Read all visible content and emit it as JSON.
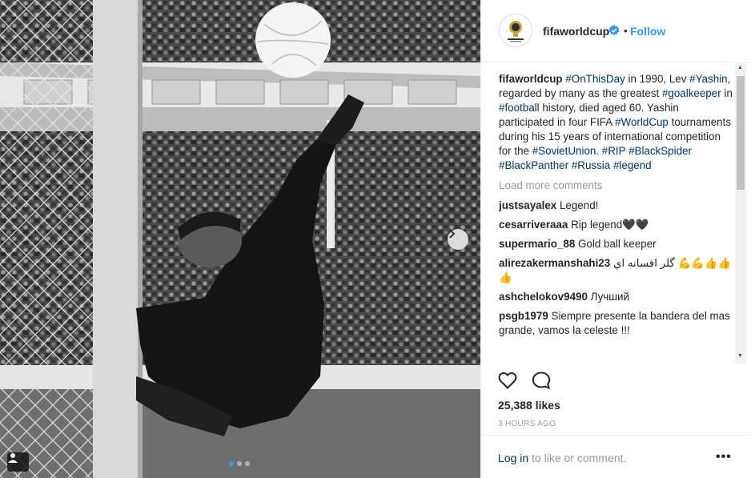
{
  "post": {
    "username": "fifaworldcup",
    "follow_label": "Follow",
    "separator": "•",
    "caption": {
      "p1": " ",
      "h1": "#OnThisDay",
      "p2": " in 1990, Lev ",
      "h2": "#Yashin",
      "p3": ", regarded by many as the greatest ",
      "h3": "#goalkeeper",
      "p4": " in ",
      "h4": "#football",
      "p5": " history, died aged 60. Yashin participated in four FIFA ",
      "h5": "#WorldCup",
      "p6": " tournaments during his 15 years of international competition for the ",
      "h6": "#SovietUnion",
      "p7": ". ",
      "h7": "#RIP",
      "h8": "#BlackSpider",
      "h9": "#BlackPanther",
      "h10": "#Russia",
      "h11": "#legend"
    },
    "load_more": "Load more comments",
    "comments": [
      {
        "user": "justsayalex",
        "text": "Legend!"
      },
      {
        "user": "cesarriveraaa",
        "text": "Rip legend🖤🖤"
      },
      {
        "user": "supermario_88",
        "text": "Gold ball keeper"
      },
      {
        "user": "alirezakermanshahi23",
        "text": "گلر افسانه اي 💪💪👍👍👍"
      },
      {
        "user": "ashchelokov9490",
        "text": "Лучший"
      },
      {
        "user": "psgb1979",
        "text": "Siempre presente la bandera del mas grande, vamos la celeste !!!"
      }
    ],
    "likes": "25,388 likes",
    "time": "3 HOURS AGO",
    "login_link": "Log in",
    "login_rest": " to like or comment.",
    "more_label": "•••",
    "carousel": {
      "slides": 3,
      "active": 1
    }
  },
  "icons": {
    "like": "heart-outline-icon",
    "comment": "speech-bubble-icon",
    "verified": "verified-badge-icon",
    "next": "chevron-right-icon",
    "tag": "user-tag-icon",
    "more": "more-options-icon"
  },
  "colors": {
    "link": "#3897f0",
    "hashtag": "#003569",
    "muted": "#999999",
    "text": "#262626"
  }
}
